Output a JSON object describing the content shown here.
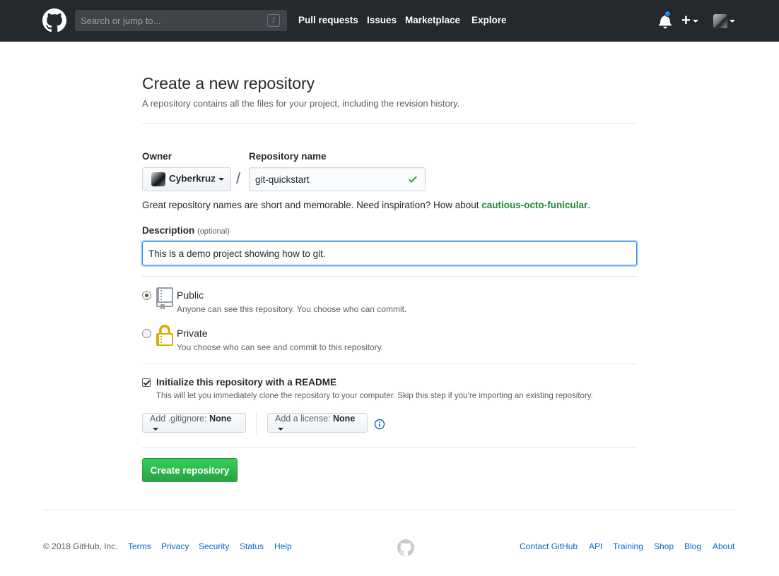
{
  "header": {
    "search": {
      "placeholder": "Search or jump to...",
      "shortcut": "/"
    },
    "nav": [
      "Pull requests",
      "Issues",
      "Marketplace",
      "Explore"
    ],
    "plus_label": "+",
    "colors": {
      "bg": "#24292e",
      "notification": "#2188ff"
    }
  },
  "page": {
    "title": "Create a new repository",
    "subtitle": "A repository contains all the files for your project, including the revision history."
  },
  "form": {
    "owner_label": "Owner",
    "owner_value": "Cyberkruz",
    "separator": "/",
    "repo_name_label": "Repository name",
    "repo_name_value": "git-quickstart",
    "hint_prefix": "Great repository names are short and memorable. Need inspiration? How about ",
    "hint_suggestion": "cautious-octo-funicular",
    "hint_suffix": ".",
    "description_label": "Description",
    "description_optional": "(optional)",
    "description_value": "This is a demo project showing how to git.",
    "visibility": {
      "public_title": "Public",
      "public_desc": "Anyone can see this repository. You choose who can commit.",
      "private_title": "Private",
      "private_desc": "You choose who can see and commit to this repository.",
      "selected": "public"
    },
    "init_readme_label": "Initialize this repository with a README",
    "init_readme_checked": true,
    "init_readme_desc": "This will let you immediately clone the repository to your computer. Skip this step if you’re importing an existing repository.",
    "gitignore_label": "Add .gitignore:",
    "gitignore_value": "None",
    "license_label": "Add a license:",
    "license_value": "None",
    "submit_label": "Create repository",
    "colors": {
      "primary_green": "#28a745",
      "focus_blue": "#2188ff",
      "link_blue": "#0366d6"
    }
  },
  "footer": {
    "copyright": "© 2018 GitHub, Inc.",
    "left_links": [
      "Terms",
      "Privacy",
      "Security",
      "Status",
      "Help"
    ],
    "right_links": [
      "Contact GitHub",
      "API",
      "Training",
      "Shop",
      "Blog",
      "About"
    ]
  }
}
